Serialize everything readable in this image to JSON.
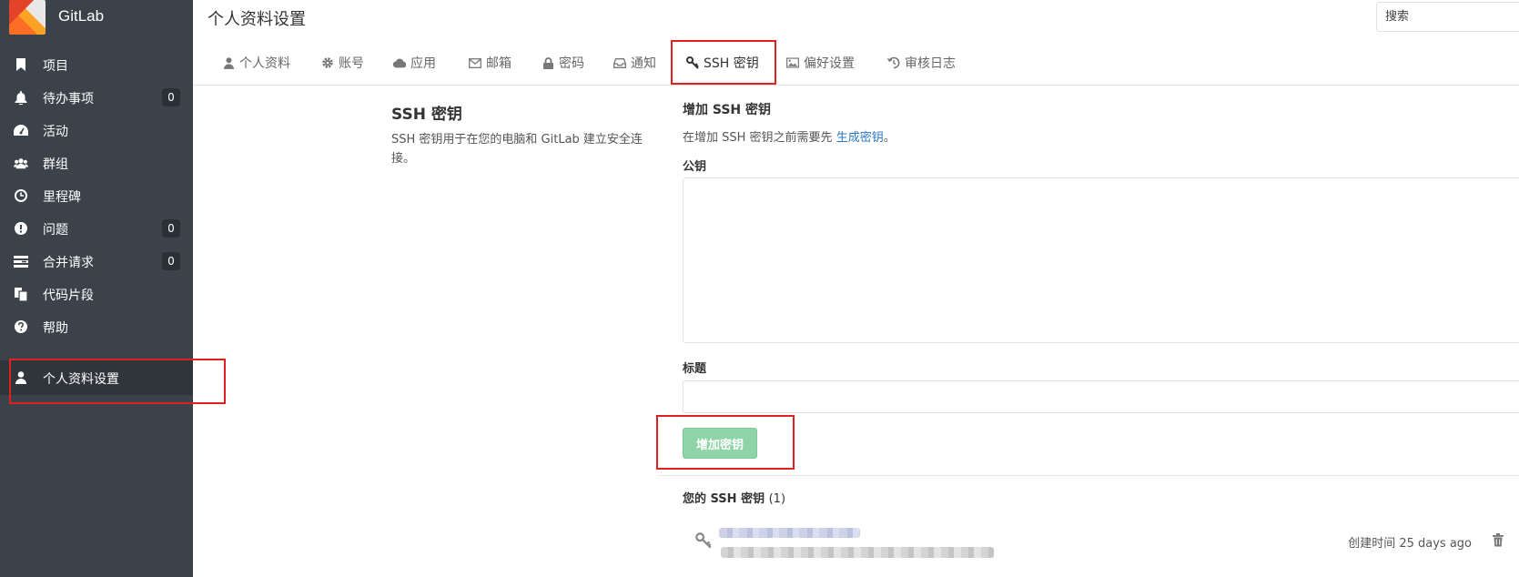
{
  "app": {
    "brand": "GitLab"
  },
  "sidebar": {
    "items": [
      {
        "label": "项目",
        "icon": "bookmark-icon"
      },
      {
        "label": "待办事项",
        "icon": "bell-icon",
        "badge": "0"
      },
      {
        "label": "活动",
        "icon": "dashboard-icon"
      },
      {
        "label": "群组",
        "icon": "users-icon"
      },
      {
        "label": "里程碑",
        "icon": "clock-icon"
      },
      {
        "label": "问题",
        "icon": "exclamation-icon",
        "badge": "0"
      },
      {
        "label": "合并请求",
        "icon": "tasks-icon",
        "badge": "0"
      },
      {
        "label": "代码片段",
        "icon": "copy-icon"
      },
      {
        "label": "帮助",
        "icon": "question-icon"
      },
      {
        "label": "个人资料设置",
        "icon": "user-icon",
        "active": true
      }
    ]
  },
  "header": {
    "title": "个人资料设置",
    "search_placeholder": "搜索"
  },
  "tabs": [
    {
      "label": "个人资料",
      "icon": "user-icon"
    },
    {
      "label": "账号",
      "icon": "gear-icon"
    },
    {
      "label": "应用",
      "icon": "cloud-icon"
    },
    {
      "label": "邮箱",
      "icon": "envelope-icon"
    },
    {
      "label": "密码",
      "icon": "lock-icon"
    },
    {
      "label": "通知",
      "icon": "inbox-icon"
    },
    {
      "label": "SSH 密钥",
      "icon": "key-icon",
      "active": true
    },
    {
      "label": "偏好设置",
      "icon": "image-icon"
    },
    {
      "label": "审核日志",
      "icon": "history-icon"
    }
  ],
  "section": {
    "title": "SSH 密钥",
    "description": "SSH 密钥用于在您的电脑和 GitLab 建立安全连接。"
  },
  "form": {
    "title": "增加 SSH 密钥",
    "hint_prefix": "在增加 SSH 密钥之前需要先",
    "hint_link": "生成密钥",
    "hint_suffix": "。",
    "pubkey_label": "公钥",
    "title_label": "标题",
    "add_button": "增加密钥"
  },
  "keys": {
    "heading": "您的 SSH 密钥",
    "count": "(1)",
    "items": [
      {
        "created": "创建时间 25 days ago",
        "icon": "key-icon",
        "delete_icon": "trash-icon"
      }
    ]
  },
  "colors": {
    "sidebar_bg": "#3b4249",
    "highlight": "#e02020",
    "button_green": "#8fd4a7",
    "link": "#2a78c6"
  }
}
